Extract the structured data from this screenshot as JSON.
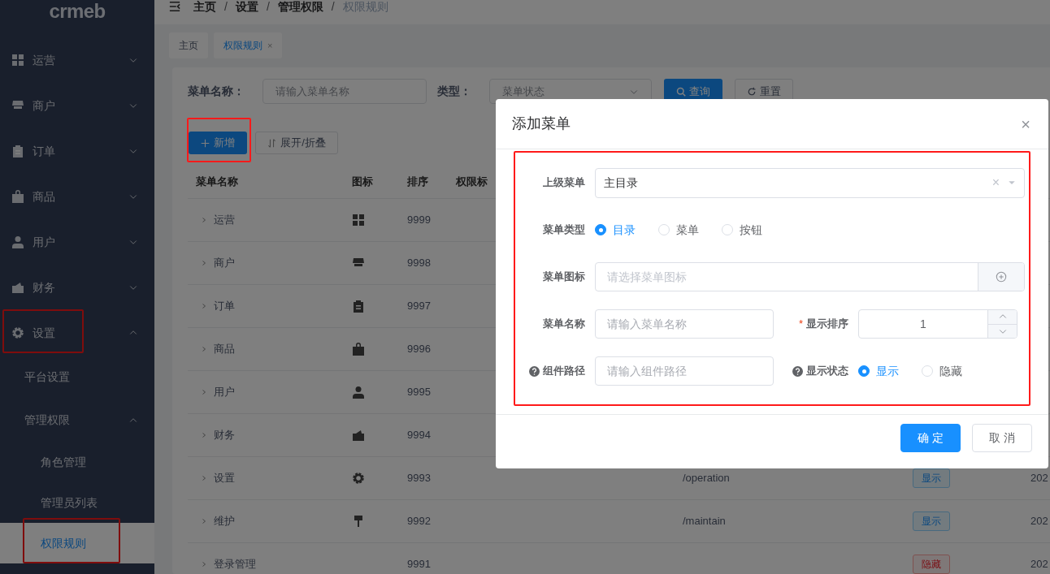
{
  "logo": "crmeb",
  "breadcrumb": [
    "主页",
    "设置",
    "管理权限",
    "权限规则"
  ],
  "breadcrumb_separator": "/",
  "tabs": [
    {
      "label": "主页",
      "selected": false,
      "closable": false
    },
    {
      "label": "权限规则",
      "selected": true,
      "closable": true,
      "close_label": "×"
    }
  ],
  "sidebar": {
    "items": [
      {
        "label": "运营",
        "expanded": false,
        "selected": false,
        "highlighted": false
      },
      {
        "label": "商户",
        "expanded": false,
        "selected": false,
        "highlighted": false
      },
      {
        "label": "订单",
        "expanded": false,
        "selected": false,
        "highlighted": false
      },
      {
        "label": "商品",
        "expanded": false,
        "selected": false,
        "highlighted": false
      },
      {
        "label": "用户",
        "expanded": false,
        "selected": false,
        "highlighted": false
      },
      {
        "label": "财务",
        "expanded": false,
        "selected": false,
        "highlighted": false
      },
      {
        "label": "设置",
        "expanded": true,
        "selected": false,
        "highlighted": true,
        "children": [
          {
            "label": "平台设置",
            "selected": false,
            "highlighted": false
          },
          {
            "label": "管理权限",
            "expanded": true,
            "selected": false,
            "highlighted": false,
            "children": [
              {
                "label": "角色管理",
                "selected": false,
                "highlighted": false
              },
              {
                "label": "管理员列表",
                "selected": false,
                "highlighted": false
              },
              {
                "label": "权限规则",
                "selected": true,
                "highlighted": true
              }
            ]
          }
        ]
      }
    ]
  },
  "filters": [
    {
      "kind": "input",
      "label": "菜单名称：",
      "placeholder": "请输入菜单名称"
    },
    {
      "kind": "select",
      "label": "类型：",
      "placeholder": "菜单状态"
    }
  ],
  "search_button": "查询",
  "reset_button": "重置",
  "toolbar": {
    "add_button": {
      "label": "新增",
      "highlighted": true
    },
    "toggle_button": "展开/折叠"
  },
  "table": {
    "columns": [
      "菜单名称",
      "图标",
      "排序",
      "权限标"
    ],
    "rows": [
      {
        "name": "运营",
        "has_icon": true,
        "sort": "9999"
      },
      {
        "name": "商户",
        "has_icon": true,
        "sort": "9998"
      },
      {
        "name": "订单",
        "has_icon": true,
        "sort": "9997"
      },
      {
        "name": "商品",
        "has_icon": true,
        "sort": "9996"
      },
      {
        "name": "用户",
        "has_icon": true,
        "sort": "9995"
      },
      {
        "name": "财务",
        "has_icon": true,
        "sort": "9994"
      },
      {
        "name": "设置",
        "has_icon": true,
        "sort": "9993",
        "path": "/operation",
        "status": {
          "label": "显示",
          "kind": "shown"
        },
        "date": "202"
      },
      {
        "name": "维护",
        "has_icon": true,
        "sort": "9992",
        "path": "/maintain",
        "status": {
          "label": "显示",
          "kind": "shown"
        },
        "date": "202"
      },
      {
        "name": "登录管理",
        "has_icon": false,
        "sort": "9991",
        "status": {
          "label": "隐藏",
          "kind": "hidden"
        },
        "date": "202"
      }
    ]
  },
  "dialog": {
    "title": "添加菜单",
    "close_label": "×",
    "highlighted": true,
    "rows": [
      [
        {
          "kind": "select",
          "label": "上级菜单",
          "value": "主目录",
          "clear_label": "×"
        }
      ],
      [
        {
          "kind": "radio",
          "label": "菜单类型",
          "options": [
            {
              "label": "目录",
              "selected": true
            },
            {
              "label": "菜单",
              "selected": false
            },
            {
              "label": "按钮",
              "selected": false
            }
          ]
        }
      ],
      [
        {
          "kind": "icon-input",
          "label": "菜单图标",
          "placeholder": "请选择菜单图标"
        }
      ],
      [
        {
          "kind": "input",
          "label": "菜单名称",
          "placeholder": "请输入菜单名称"
        },
        {
          "kind": "number",
          "label": "显示排序",
          "required_mark": "*",
          "value": "1"
        }
      ],
      [
        {
          "kind": "input",
          "label": "组件路径",
          "help": true,
          "placeholder": "请输入组件路径"
        },
        {
          "kind": "radio",
          "label": "显示状态",
          "help": true,
          "options": [
            {
              "label": "显示",
              "selected": true
            },
            {
              "label": "隐藏",
              "selected": false
            }
          ]
        }
      ]
    ],
    "buttons": [
      {
        "label": "确 定",
        "kind": "primary"
      },
      {
        "label": "取 消",
        "kind": "default"
      }
    ]
  }
}
